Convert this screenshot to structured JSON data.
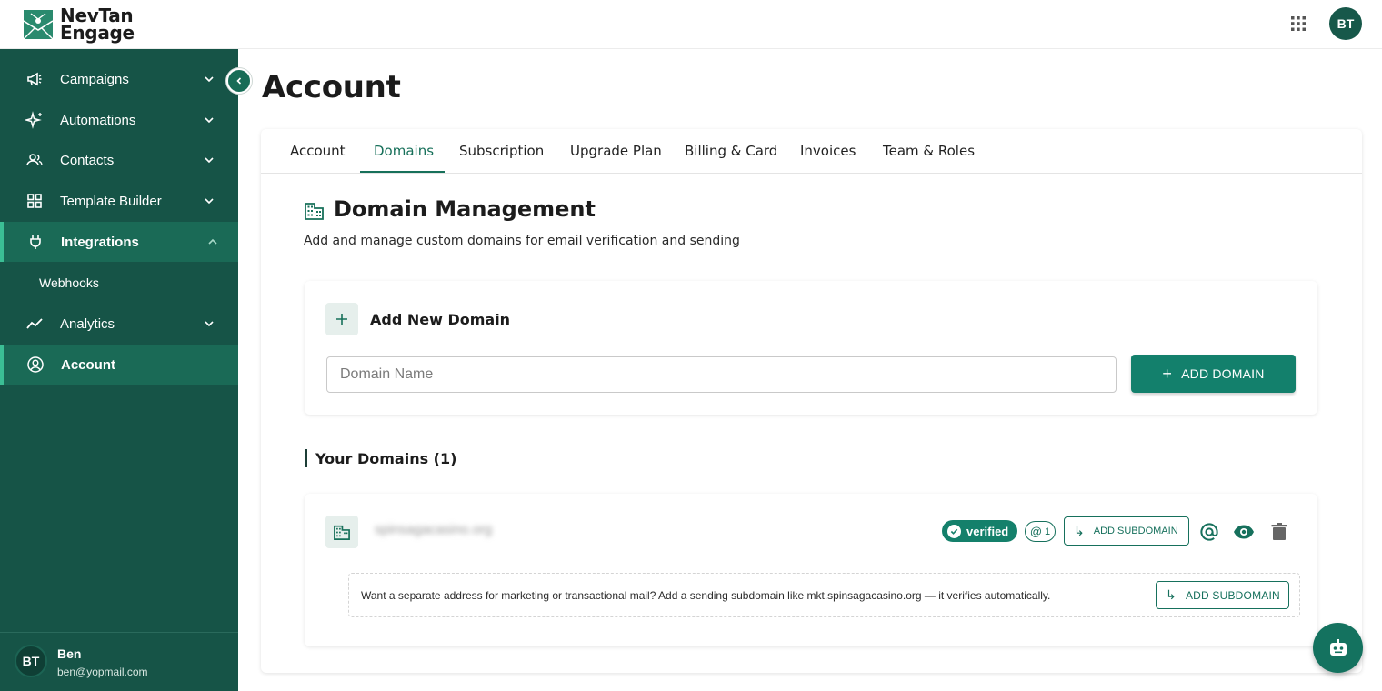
{
  "brand": {
    "line1": "NevTan",
    "line2": "Engage"
  },
  "header": {
    "avatar_initials": "BT"
  },
  "sidebar": {
    "items": [
      {
        "label": "Campaigns"
      },
      {
        "label": "Automations"
      },
      {
        "label": "Contacts"
      },
      {
        "label": "Template Builder"
      },
      {
        "label": "Integrations"
      },
      {
        "label": "Webhooks"
      },
      {
        "label": "Analytics"
      },
      {
        "label": "Account"
      }
    ],
    "user": {
      "initials": "BT",
      "name": "Ben",
      "email": "ben@yopmail.com"
    }
  },
  "page": {
    "title": "Account"
  },
  "tabs": [
    {
      "label": "Account"
    },
    {
      "label": "Domains"
    },
    {
      "label": "Subscription"
    },
    {
      "label": "Upgrade Plan"
    },
    {
      "label": "Billing & Card"
    },
    {
      "label": "Invoices"
    },
    {
      "label": "Team & Roles"
    }
  ],
  "domain_management": {
    "title": "Domain Management",
    "subtitle": "Add and manage custom domains for email verification and sending",
    "add": {
      "title": "Add New Domain",
      "placeholder": "Domain Name",
      "button_label": "ADD DOMAIN"
    },
    "your_domains_title": "Your Domains (1)",
    "domains": [
      {
        "name": "spinsagacasino.org",
        "status": "verified",
        "sender_count": "1",
        "add_subdomain_label": "ADD SUBDOMAIN",
        "hint": "Want a separate address for marketing or transactional mail? Add a sending subdomain like mkt.spinsagacasino.org — it verifies automatically.",
        "hint_button_label": "ADD SUBDOMAIN"
      }
    ]
  },
  "colors": {
    "sidebar": "#165447",
    "accent": "#13806c",
    "active_item": "#1a6a56"
  }
}
